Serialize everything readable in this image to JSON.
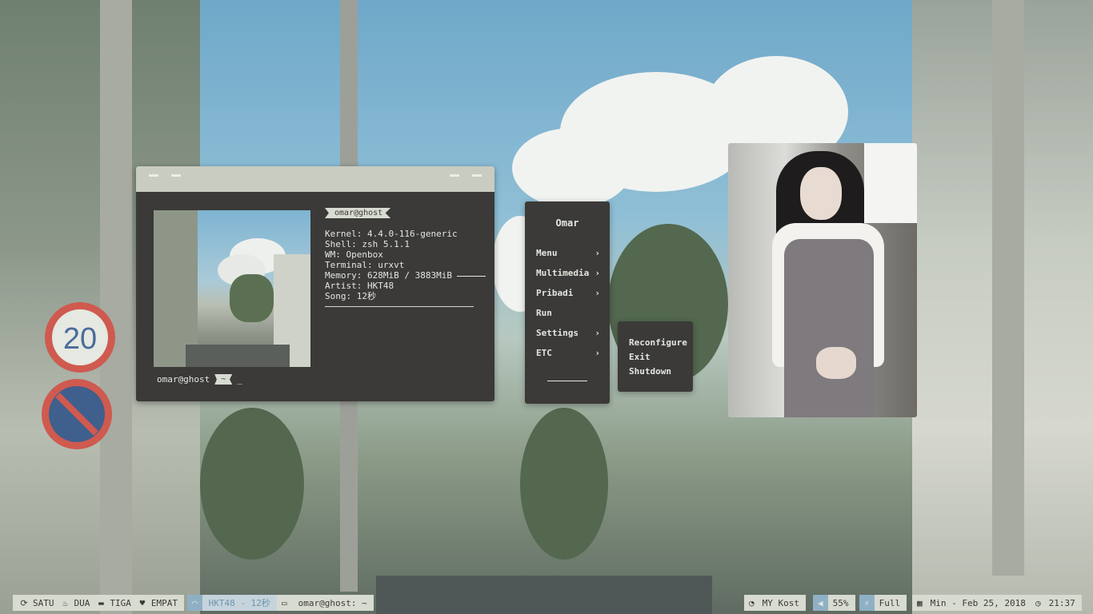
{
  "terminal": {
    "tag": "omar@ghost",
    "info": [
      "Kernel: 4.4.0-116-generic",
      "Shell: zsh 5.1.1",
      "WM: Openbox",
      "Terminal: urxvt",
      "Memory: 628MiB / 3883MiB",
      "Artist: HKT48",
      "Song: 12秒"
    ],
    "prompt_user": "omar@ghost",
    "prompt_dir": "~",
    "prompt_cursor": "_"
  },
  "menu": {
    "title": "Omar",
    "items": [
      {
        "label": "Menu",
        "arrow": "›"
      },
      {
        "label": "Multimedia",
        "arrow": "›"
      },
      {
        "label": "Pribadi",
        "arrow": "›"
      },
      {
        "label": "Run",
        "arrow": ""
      },
      {
        "label": "Settings",
        "arrow": "›"
      },
      {
        "label": "ETC",
        "arrow": "›"
      }
    ]
  },
  "submenu": {
    "items": [
      "Reconfigure",
      "Exit",
      "Shutdown"
    ]
  },
  "taskbar": {
    "workspaces": [
      {
        "icon": "refresh-icon",
        "label": "SATU"
      },
      {
        "icon": "fire-icon",
        "label": "DUA"
      },
      {
        "icon": "folder-icon",
        "label": "TIGA"
      },
      {
        "icon": "heartbeat-icon",
        "label": "EMPAT"
      }
    ],
    "music": {
      "icon": "headphones-icon",
      "label": "HKT48 - 12秒"
    },
    "window": {
      "icon": "monitor-icon",
      "label": "omar@ghost: ~"
    },
    "wifi": {
      "icon": "wifi-icon",
      "label": "MY Kost"
    },
    "volume": {
      "icon": "volume-icon",
      "label": "55%"
    },
    "battery": {
      "icon": "plug-icon",
      "label": "Full"
    },
    "date": {
      "icon": "calendar-icon",
      "label": "Min - Feb 25, 2018"
    },
    "clock": {
      "icon": "clock-icon",
      "label": "21:37"
    }
  },
  "colors": {
    "panel": "#3b3a38",
    "panel_light": "#d8dbd1",
    "accent": "#8fb0c4",
    "text": "#e4e6df"
  }
}
